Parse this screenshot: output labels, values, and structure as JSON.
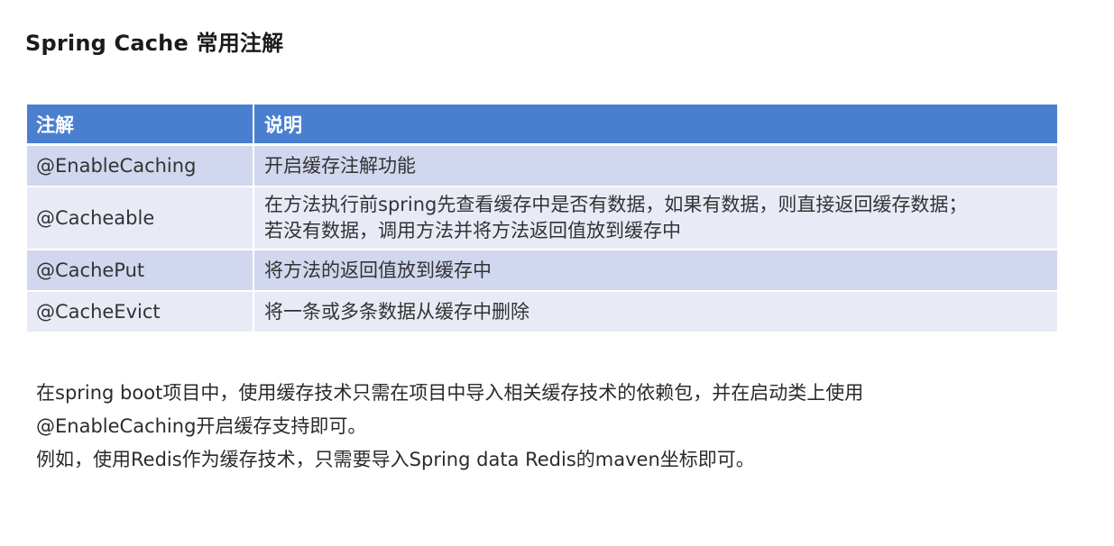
{
  "title": "Spring Cache 常用注解",
  "table": {
    "headers": [
      "注解",
      "说明"
    ],
    "rows": [
      {
        "annotation": "@EnableCaching",
        "description": [
          "开启缓存注解功能"
        ]
      },
      {
        "annotation": "@Cacheable",
        "description": [
          "在方法执行前spring先查看缓存中是否有数据，如果有数据，则直接返回缓存数据；",
          "若没有数据，调用方法并将方法返回值放到缓存中"
        ]
      },
      {
        "annotation": "@CachePut",
        "description": [
          "将方法的返回值放到缓存中"
        ]
      },
      {
        "annotation": "@CacheEvict",
        "description": [
          "将一条或多条数据从缓存中删除"
        ]
      }
    ],
    "colors": {
      "header_bg": "#4a7fcf",
      "row_odd_bg": "#d1d7ee",
      "row_even_bg": "#e8ebf6"
    }
  },
  "notes": [
    "在spring boot项目中，使用缓存技术只需在项目中导入相关缓存技术的依赖包，并在启动类上使用",
    "@EnableCaching开启缓存支持即可。",
    "例如，使用Redis作为缓存技术，只需要导入Spring data Redis的maven坐标即可。"
  ]
}
